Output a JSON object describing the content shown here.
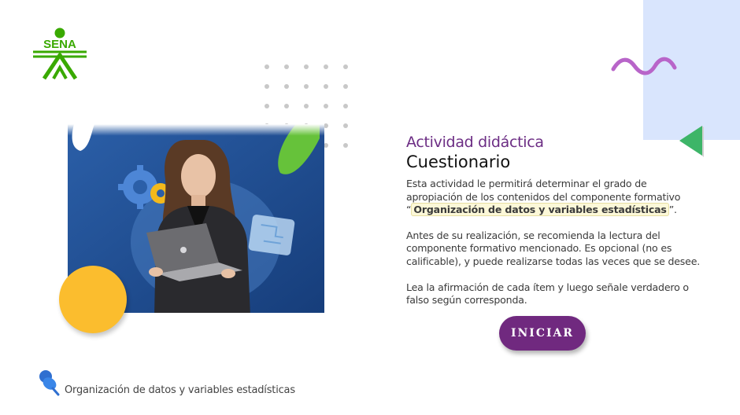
{
  "brand": {
    "logo_text": "SENA",
    "color": "#39a900"
  },
  "content": {
    "eyebrow": "Actividad didáctica",
    "title": "Cuestionario",
    "p1_before": "Esta actividad le permitirá determinar el grado de apropiación de los contenidos del componente formativo “",
    "p1_highlight": "Organización de datos y variables estadísticas",
    "p1_after": "”.",
    "p2": "Antes de su realización, se recomienda la lectura del componente formativo mencionado.  Es opcional (no es calificable), y puede realizarse todas las veces que se desee.",
    "p3": "Lea la afirmación de cada ítem y luego señale verdadero o falso según corresponda."
  },
  "start_button": {
    "label": "INICIAR"
  },
  "footer": {
    "label": "Organización de datos y variables estadísticas",
    "icon": "pushpin-icon"
  },
  "colors": {
    "accent": "#6c2d84",
    "button": "#70297f",
    "green": "#39a900",
    "yellow": "#fbbd2e",
    "light_blue": "#d9e5fd",
    "wave": "#b865c9"
  }
}
